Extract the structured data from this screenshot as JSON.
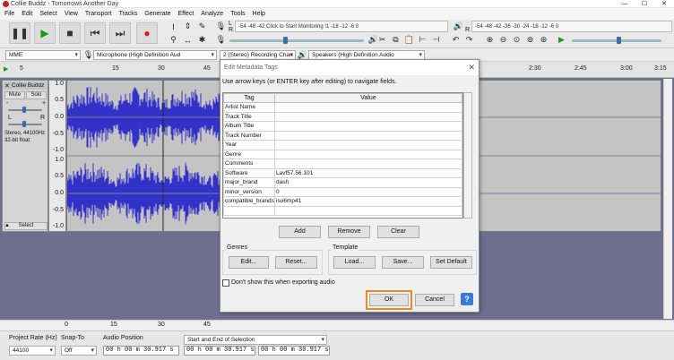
{
  "window": {
    "title": "Collie Buddz - Tomorrows Another Day",
    "min": "—",
    "max": "☐",
    "close": "✕"
  },
  "menu": [
    "File",
    "Edit",
    "Select",
    "View",
    "Transport",
    "Tracks",
    "Generate",
    "Effect",
    "Analyze",
    "Tools",
    "Help"
  ],
  "meters": {
    "record_ticks": "-54   -48   -42   Click to Start Monitoring   !1   -18   -12   -6   0",
    "play_ticks": "-54   -48   -42   -36   -30   -24   -18   -12   -6   0",
    "record_label": "R",
    "play_label": "R"
  },
  "devices": {
    "host": "MME",
    "mic": "Microphone (High Definition Aud",
    "channels": "2 (Stereo) Recording Chan",
    "speakers": "Speakers (High Definition Audio"
  },
  "ruler": {
    "ticks": [
      "5",
      "15",
      "30",
      "45",
      "2:30",
      "2:45",
      "3:00",
      "3:15"
    ],
    "bottom_ticks": [
      "0",
      "15",
      "30",
      "45"
    ]
  },
  "track": {
    "name": "Collie Buddz",
    "mute": "Mute",
    "solo": "Solo",
    "gain_minus": "-",
    "gain_plus": "+",
    "pan_left": "L",
    "pan_right": "R",
    "info": "Stereo, 44100Hz\n32-bit float",
    "select": "Select",
    "scale_top": [
      "1.0",
      "0.5",
      "0.0",
      "-0.5",
      "-1.0"
    ],
    "scale_bottom": [
      "1.0",
      "0.5",
      "0.0",
      "-0.5",
      "-1.0"
    ],
    "waveform_color": "#3232c8"
  },
  "dialog": {
    "title": "Edit Metadata Tags",
    "close": "✕",
    "instructions": "Use arrow keys (or ENTER key after editing) to navigate fields.",
    "columns": [
      "Tag",
      "Value"
    ],
    "rows": [
      {
        "tag": "Artist Name",
        "value": ""
      },
      {
        "tag": "Track Title",
        "value": ""
      },
      {
        "tag": "Album Title",
        "value": ""
      },
      {
        "tag": "Track Number",
        "value": ""
      },
      {
        "tag": "Year",
        "value": ""
      },
      {
        "tag": "Genre",
        "value": ""
      },
      {
        "tag": "Comments",
        "value": ""
      },
      {
        "tag": "Software",
        "value": "Lavf57.56.101"
      },
      {
        "tag": "major_brand",
        "value": "dash"
      },
      {
        "tag": "minor_version",
        "value": "0"
      },
      {
        "tag": "compatible_brands",
        "value": "iso6mp41"
      },
      {
        "tag": "",
        "value": ""
      }
    ],
    "add": "Add",
    "remove": "Remove",
    "clear": "Clear",
    "genres_title": "Genres",
    "genres_edit": "Edit...",
    "genres_reset": "Reset...",
    "template_title": "Template",
    "template_load": "Load...",
    "template_save": "Save...",
    "template_default": "Set Default",
    "dont_show": "Don't show this when exporting audio",
    "ok": "OK",
    "cancel": "Cancel",
    "help": "?",
    "highlight_color": "#e8892e"
  },
  "selection_bar": {
    "project_rate_label": "Project Rate (Hz)",
    "project_rate": "44100",
    "snap_label": "Snap-To",
    "snap_value": "Off",
    "audio_position_label": "Audio Position",
    "audio_position": "00 h 00 m 30.917 s",
    "range_label": "Start and End of Selection",
    "range_start": "00 h 00 m 30.917 s",
    "range_end": "00 h 00 m 30.917 s"
  }
}
